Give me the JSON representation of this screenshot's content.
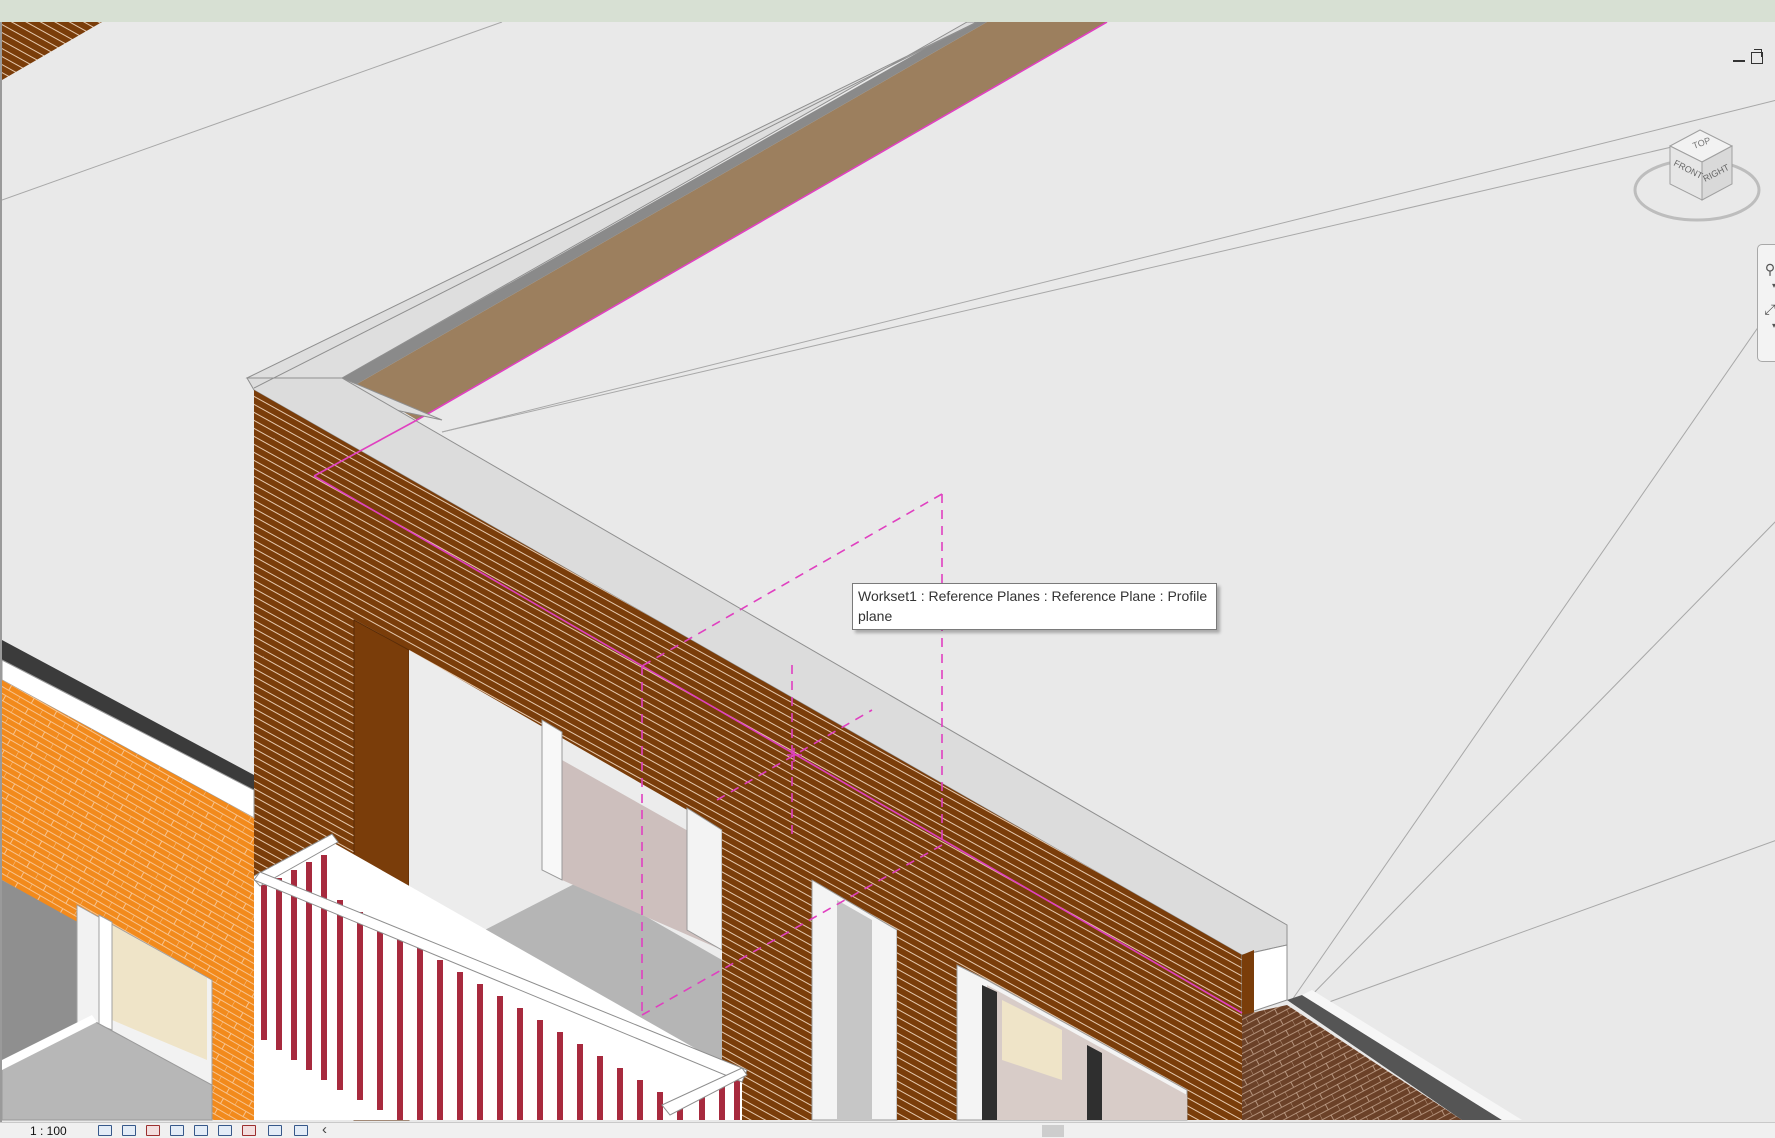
{
  "tooltip": {
    "text": "Workset1 : Reference Planes : Reference Plane : Profile plane"
  },
  "viewcube": {
    "top_label": "TOP",
    "front_label": "FRONT",
    "right_label": "RIGHT"
  },
  "status_bar": {
    "scale": "1 : 100"
  },
  "icons": {
    "view_cube": "viewcube-icon",
    "zoom": "zoom-icon",
    "zoom_extents": "zoom-extents-icon",
    "minimize": "minimize-icon",
    "restore": "restore-icon"
  },
  "colors": {
    "brick_dark": "#7a3d0a",
    "brick_orange": "#f28a1c",
    "parapet_cap": "#dedede",
    "roof_membrane": "#9c7f5e",
    "balcony_rail": "#a72a3e",
    "reference_plane": "#e040c0",
    "canvas_bg": "#e9e9e9"
  }
}
